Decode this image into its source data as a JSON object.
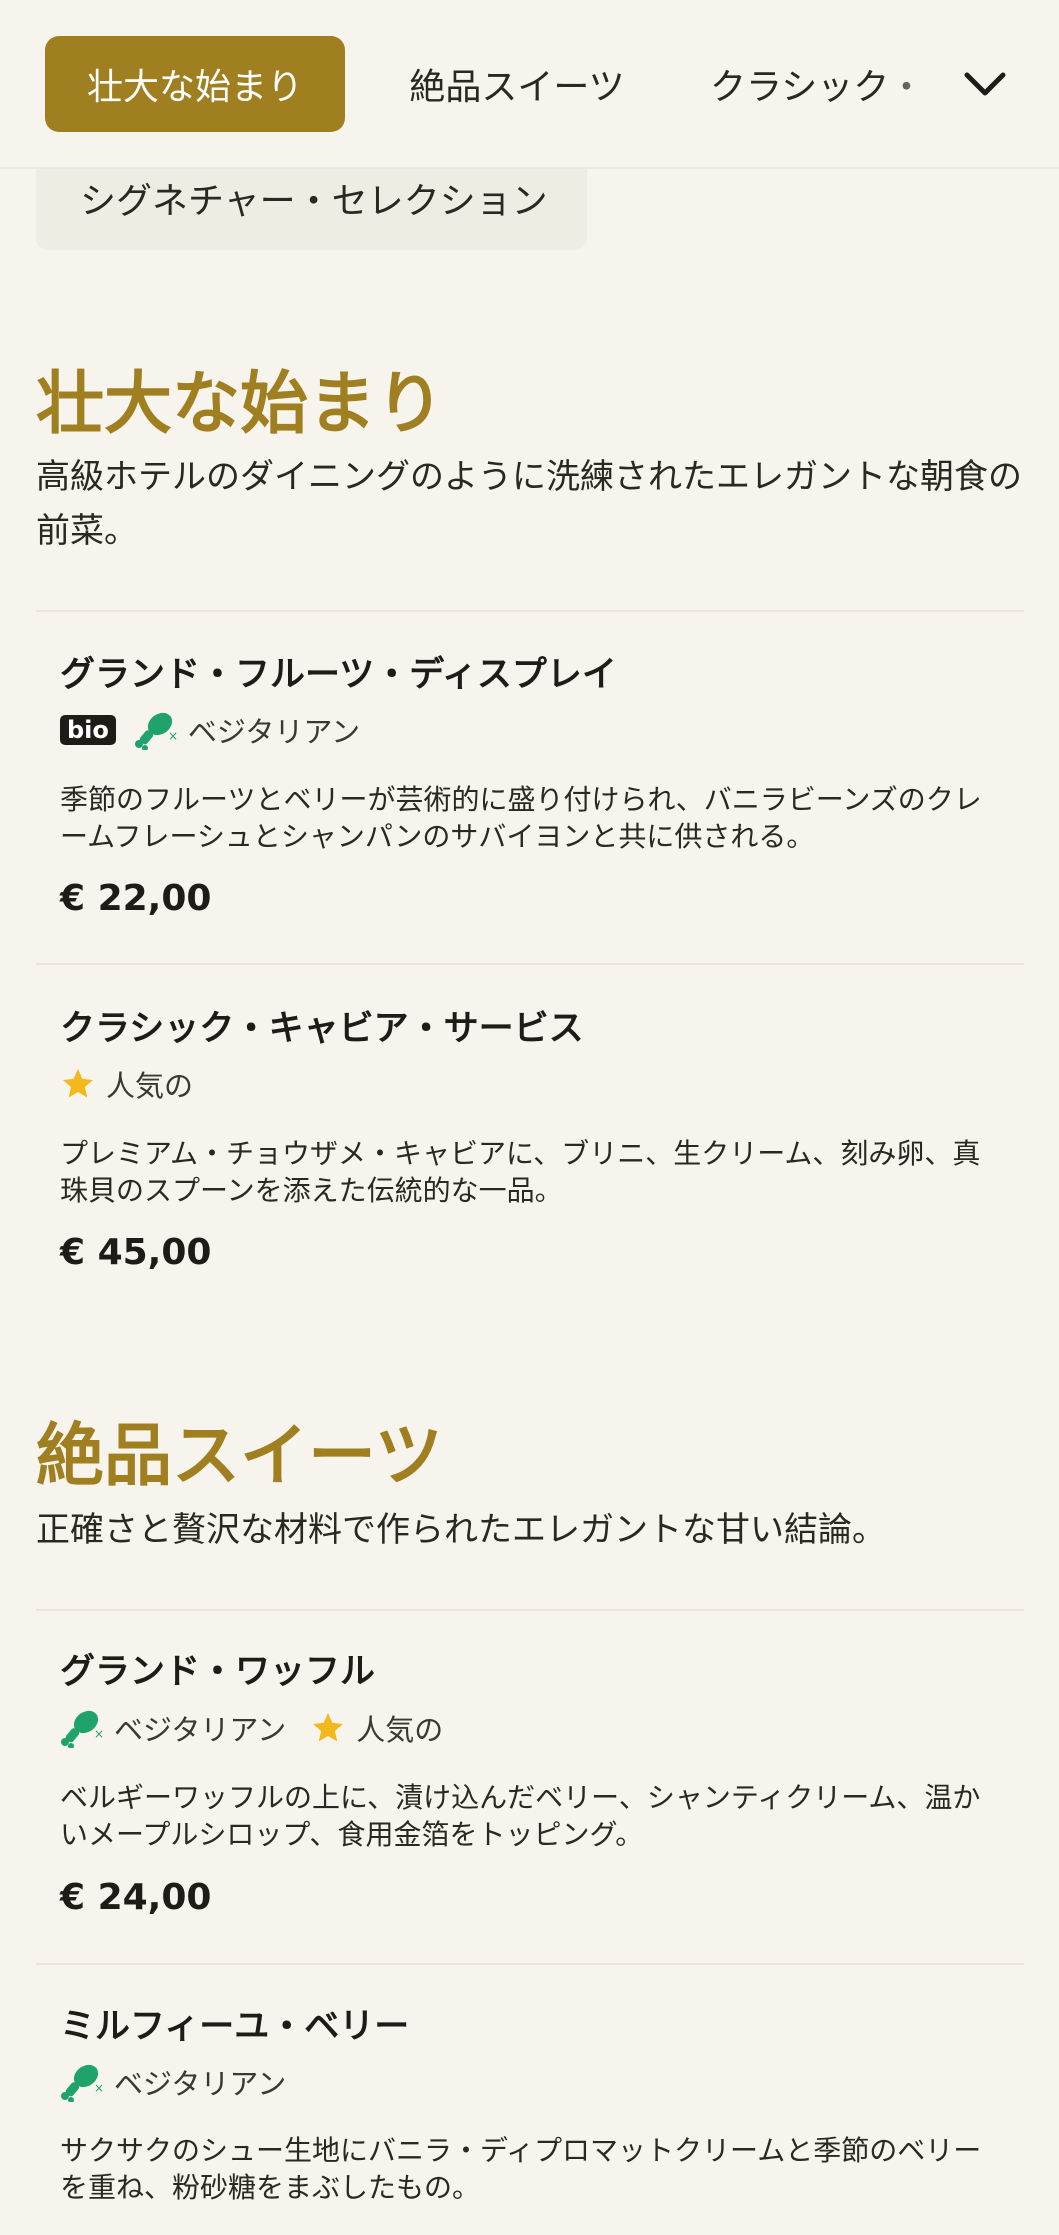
{
  "nav": {
    "tabs": [
      {
        "label": "壮大な始まり",
        "active": true
      },
      {
        "label": "絶品スイーツ",
        "active": false
      },
      {
        "label": "クラシック・",
        "active": false
      }
    ],
    "chip_label": "シグネチャー・セレクション"
  },
  "sections": [
    {
      "title": "壮大な始まり",
      "description": "高級ホテルのダイニングのように洗練されたエレガントな朝食の前菜。",
      "items": [
        {
          "name": "グランド・フルーツ・ディスプレイ",
          "badge": "bio",
          "tags": [
            "ベジタリアン"
          ],
          "description": "季節のフルーツとベリーが芸術的に盛り付けられ、バニラビーンズのクレームフレーシュとシャンパンのサバイヨンと共に供される。",
          "price": "€ 22,00"
        },
        {
          "name": "クラシック・キャビア・サービス",
          "tags": [
            "人気の"
          ],
          "description": "プレミアム・チョウザメ・キャビアに、ブリニ、生クリーム、刻み卵、真珠貝のスプーンを添えた伝統的な一品。",
          "price": "€ 45,00"
        }
      ]
    },
    {
      "title": "絶品スイーツ",
      "description": "正確さと贅沢な材料で作られたエレガントな甘い結論。",
      "items": [
        {
          "name": "グランド・ワッフル",
          "tags": [
            "ベジタリアン",
            "人気の"
          ],
          "description": "ベルギーワッフルの上に、漬け込んだベリー、シャンティクリーム、温かいメープルシロップ、食用金箔をトッピング。",
          "price": "€ 24,00"
        },
        {
          "name": "ミルフィーユ・ベリー",
          "tags": [
            "ベジタリアン"
          ],
          "description": "サクサクのシュー生地にバニラ・ディプロマットクリームと季節のベリーを重ね、粉砂糖をまぶしたもの。"
        }
      ]
    }
  ],
  "icons": {
    "vegetarian": "vegetarian-drumstick-icon",
    "popular": "star-icon",
    "expand": "chevron-down-icon"
  },
  "colors": {
    "accent": "#a07f20",
    "background": "#f7f4ee",
    "vegetarian": "#1fa36b",
    "star": "#f2b81c"
  }
}
